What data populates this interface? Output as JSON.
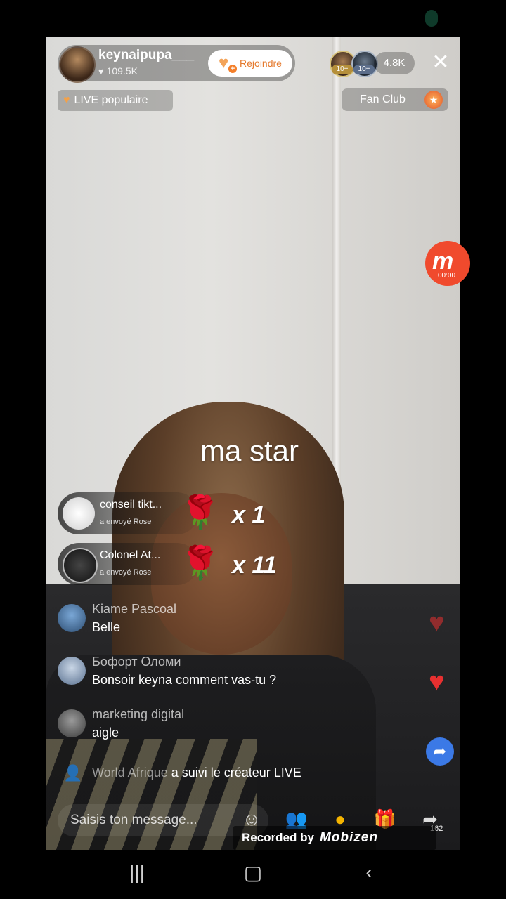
{
  "host": {
    "name": "keynaipupa___",
    "likes": "109.5K",
    "join_label": "Rejoindre"
  },
  "viewers": {
    "badge_1": "10+",
    "badge_2": "10+",
    "count": "4.8K"
  },
  "tags": {
    "live_popular": "LIVE populaire",
    "fan_club": "Fan Club"
  },
  "recorder_timer": "00:00",
  "overlay_text": "ma star",
  "gifts": [
    {
      "sender": "conseil tikt...",
      "action": "a envoyé",
      "gift": "Rose",
      "count": "x 1"
    },
    {
      "sender": "Colonel At...",
      "action": "a envoyé",
      "gift": "Rose",
      "count": "x 11"
    }
  ],
  "comments": [
    {
      "user": "Kiame Pascoal",
      "text": "Belle"
    },
    {
      "user": "Бофорт Оломи",
      "text": "Bonsoir keyna comment vas-tu ?"
    },
    {
      "user": "marketing digital",
      "text": "aigle"
    }
  ],
  "follow_event": {
    "user": "World Afrique",
    "text": "a suivi le créateur LIVE"
  },
  "input": {
    "placeholder": "Saisis ton message..."
  },
  "share_count": "162",
  "recorded": {
    "label": "Recorded by",
    "brand": "Mobizen"
  },
  "icons": {
    "close": "close-icon",
    "heart": "heart-icon",
    "emoji": "emoji-icon",
    "collab": "collab-icon",
    "coin": "coin-icon",
    "gift": "gift-icon",
    "share": "share-icon"
  },
  "colors": {
    "join_text": "#e57a2e",
    "like_heart": "#e83030",
    "share_float": "#3b79e6",
    "mobizen": "#f04a2d"
  }
}
